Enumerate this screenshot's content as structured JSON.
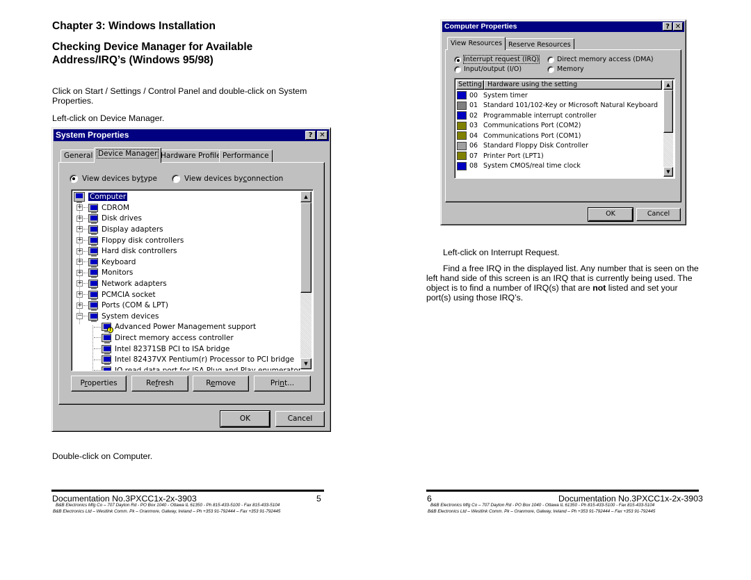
{
  "left_page": {
    "chapter_title": "Chapter 3:  Windows Installation",
    "section_title": "Checking Device Manager for Available Address/IRQ’s (Windows 95/98)",
    "instruction_1": "Click on Start / Settings / Control Panel and double-click on System Properties.",
    "instruction_2": "Left-click on Device Manager.",
    "instruction_3": "Double-click on Computer.",
    "footer": {
      "doc_number": "Documentation No.3PXCC1x-2x-3903",
      "page_number": "5",
      "address_1": "B&B Electronics Mfg Co – 707 Dayton Rd - PO Box 1040 - Ottawa IL 61350 - Ph 815-433-5100 - Fax 815-433-5104",
      "address_2": "B&B Electronics Ltd – Westlink Comm. Pk – Oranmore, Galway, Ireland – Ph +353 91-792444 – Fax +353 91-792445"
    }
  },
  "system_properties": {
    "title": "System Properties",
    "help_button": "?",
    "close_button": "✕",
    "tabs": [
      {
        "label": "General",
        "active": false
      },
      {
        "label": "Device Manager",
        "active": true
      },
      {
        "label": "Hardware Profiles",
        "active": false
      },
      {
        "label": "Performance",
        "active": false
      }
    ],
    "radio_by_type": {
      "pre": "View devices by ",
      "accel": "t",
      "post": "ype",
      "selected": true
    },
    "radio_by_connection": {
      "pre": "View devices by ",
      "accel": "c",
      "post": "onnection",
      "selected": false
    },
    "tree": {
      "root": "Computer",
      "items": [
        {
          "label": "CDROM",
          "icon": "cdrom-icon",
          "expanded": false
        },
        {
          "label": "Disk drives",
          "icon": "disk-drive-icon",
          "expanded": false
        },
        {
          "label": "Display adapters",
          "icon": "display-adapter-icon",
          "expanded": false
        },
        {
          "label": "Floppy disk controllers",
          "icon": "floppy-controller-icon",
          "expanded": false
        },
        {
          "label": "Hard disk controllers",
          "icon": "hard-disk-controller-icon",
          "expanded": false
        },
        {
          "label": "Keyboard",
          "icon": "keyboard-icon",
          "expanded": false
        },
        {
          "label": "Monitors",
          "icon": "monitor-icon",
          "expanded": false
        },
        {
          "label": "Network adapters",
          "icon": "network-adapter-icon",
          "expanded": false
        },
        {
          "label": "PCMCIA socket",
          "icon": "pcmcia-icon",
          "expanded": false
        },
        {
          "label": "Ports (COM & LPT)",
          "icon": "port-icon",
          "expanded": false
        },
        {
          "label": "System devices",
          "icon": "system-device-icon",
          "expanded": true
        }
      ],
      "children": [
        {
          "label": "Advanced Power Management support",
          "warning": true
        },
        {
          "label": "Direct memory access controller",
          "warning": false
        },
        {
          "label": "Intel 82371SB PCI to ISA bridge",
          "warning": false
        },
        {
          "label": "Intel 82437VX Pentium(r) Processor to PCI bridge",
          "warning": false
        },
        {
          "label": "IO read data port for ISA Plug and Play enumerator",
          "warning": false
        }
      ]
    },
    "buttons": {
      "properties": {
        "pre": "P",
        "accel": "r",
        "post": "operties"
      },
      "refresh": {
        "pre": "Re",
        "accel": "f",
        "post": "resh"
      },
      "remove": {
        "pre": "R",
        "accel": "e",
        "post": "move"
      },
      "print": {
        "pre": "Pri",
        "accel": "n",
        "post": "t..."
      },
      "ok": "OK",
      "cancel": "Cancel"
    }
  },
  "computer_properties": {
    "title": "Computer Properties",
    "help_button": "?",
    "close_button": "✕",
    "tabs": [
      {
        "label": "View Resources",
        "active": true
      },
      {
        "label": "Reserve Resources",
        "active": false
      }
    ],
    "radios": [
      {
        "label": "Interrupt request (IRQ)",
        "selected": true
      },
      {
        "label": "Direct memory access (DMA)",
        "selected": false
      },
      {
        "label": "Input/output (I/O)",
        "selected": false
      },
      {
        "label": "Memory",
        "selected": false
      }
    ],
    "columns": [
      "Setting",
      "Hardware using the setting"
    ],
    "rows": [
      {
        "setting": "00",
        "hardware": "System timer",
        "icon": "system-device-icon"
      },
      {
        "setting": "01",
        "hardware": "Standard 101/102-Key or Microsoft Natural Keyboard",
        "icon": "keyboard-icon"
      },
      {
        "setting": "02",
        "hardware": "Programmable interrupt controller",
        "icon": "system-device-icon"
      },
      {
        "setting": "03",
        "hardware": "Communications Port (COM2)",
        "icon": "port-icon"
      },
      {
        "setting": "04",
        "hardware": "Communications Port (COM1)",
        "icon": "port-icon"
      },
      {
        "setting": "06",
        "hardware": "Standard Floppy Disk Controller",
        "icon": "floppy-controller-icon"
      },
      {
        "setting": "07",
        "hardware": "Printer Port (LPT1)",
        "icon": "port-icon"
      },
      {
        "setting": "08",
        "hardware": "System CMOS/real time clock",
        "icon": "system-device-icon"
      }
    ],
    "buttons": {
      "ok": "OK",
      "cancel": "Cancel"
    }
  },
  "right_page": {
    "instruction_1": "Left-click on Interrupt Request.",
    "paragraph_pre": "Find a free IRQ in the displayed list. Any number that is seen on the left hand side of this screen is an IRQ that is currently being used. The object is to find a number of IRQ(s) that are ",
    "paragraph_bold": "not",
    "paragraph_post": " listed and set your port(s) using those IRQ’s.",
    "footer": {
      "page_number": "6",
      "doc_number": "Documentation No.3PXCC1x-2x-3903",
      "address_1": "B&B Electronics Mfg Co – 707 Dayton Rd - PO Box 1040 - Ottawa IL 61350 - Ph 815-433-5100 - Fax 815-433-5104",
      "address_2": "B&B Electronics Ltd – Westlink Comm. Pk – Oranmore, Galway, Ireland – Ph +353 91-792444 – Fax +353 91-792445"
    }
  }
}
